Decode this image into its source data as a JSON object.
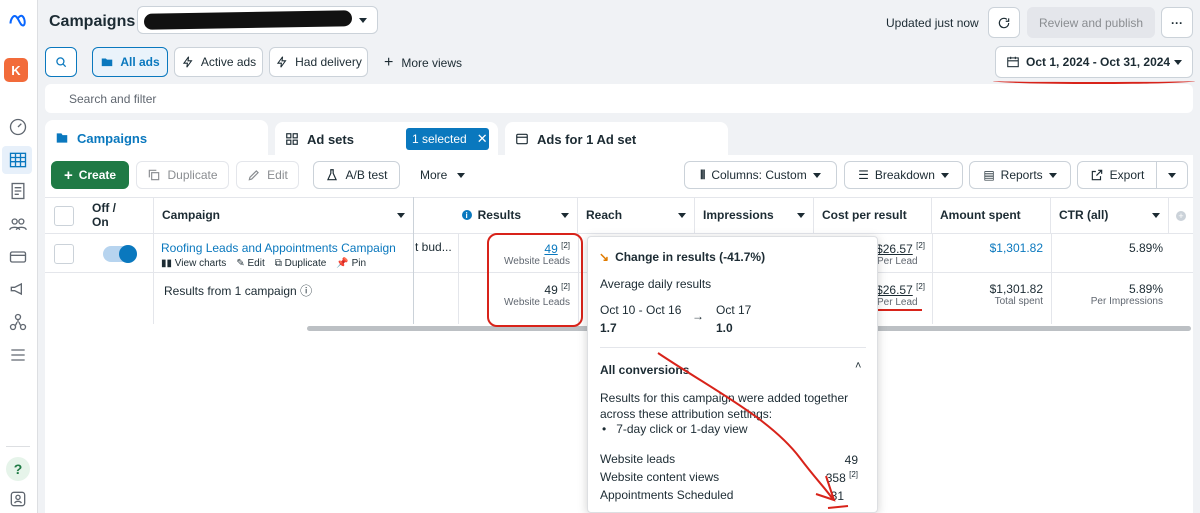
{
  "header": {
    "title": "Campaigns",
    "updated": "Updated just now",
    "review_publish": "Review and publish",
    "more": "···"
  },
  "views": {
    "all_ads": "All ads",
    "active_ads": "Active ads",
    "had_delivery": "Had delivery",
    "more_views": "More views"
  },
  "date_range": "Oct 1, 2024 - Oct 31, 2024",
  "search_placeholder": "Search and filter",
  "tabs": {
    "campaigns": "Campaigns",
    "ad_sets": "Ad sets",
    "selected": "1 selected",
    "ads": "Ads for 1 Ad set"
  },
  "toolbar": {
    "create": "Create",
    "duplicate": "Duplicate",
    "edit": "Edit",
    "ab_test": "A/B test",
    "more": "More",
    "columns": "Columns: Custom",
    "breakdown": "Breakdown",
    "reports": "Reports",
    "export": "Export"
  },
  "columns": {
    "off_on": "Off / On",
    "campaign": "Campaign",
    "results": "Results",
    "reach": "Reach",
    "impressions": "Impressions",
    "cost_per_result": "Cost per result",
    "amount_spent": "Amount spent",
    "ctr": "CTR (all)"
  },
  "row": {
    "name": "Roofing Leads and Appointments Campaign",
    "view_charts": "View charts",
    "edit": "Edit",
    "duplicate": "Duplicate",
    "pin": "Pin",
    "budget_fragment": "t bud...",
    "results": "49",
    "results_sup": "[2]",
    "results_sub": "Website Leads",
    "cost": "$26.57",
    "cost_sup": "[2]",
    "cost_sub": "Per Lead",
    "spent": "$1,301.82",
    "ctr": "5.89%"
  },
  "summary": {
    "label": "Results from 1 campaign",
    "results": "49",
    "results_sup": "[2]",
    "results_sub": "Website Leads",
    "cost": "$26.57",
    "cost_sup": "[2]",
    "cost_sub": "Per Lead",
    "spent": "$1,301.82",
    "spent_sub": "Total spent",
    "ctr": "5.89%",
    "ctr_sub": "Per Impressions"
  },
  "popup": {
    "change_title": "Change in results (-41.7%)",
    "avg_label": "Average daily results",
    "period1": "Oct 10 - Oct 16",
    "period1_val": "1.7",
    "arrow": "→",
    "period2": "Oct 17",
    "period2_val": "1.0",
    "conv_title": "All conversions",
    "conv_desc": "Results for this campaign were added together across these attribution settings:",
    "bullet": "7-day click or 1-day view",
    "items": [
      {
        "label": "Website leads",
        "value": "49",
        "sup": ""
      },
      {
        "label": "Website content views",
        "value": "358",
        "sup": "[2]"
      },
      {
        "label": "Appointments Scheduled",
        "value": "31",
        "sup": ""
      }
    ]
  },
  "rail": {
    "avatar": "K",
    "help": "?"
  },
  "colors": {
    "accent": "#0a78be",
    "create_green": "#1f7a45",
    "annotation_red": "#d8231a"
  }
}
